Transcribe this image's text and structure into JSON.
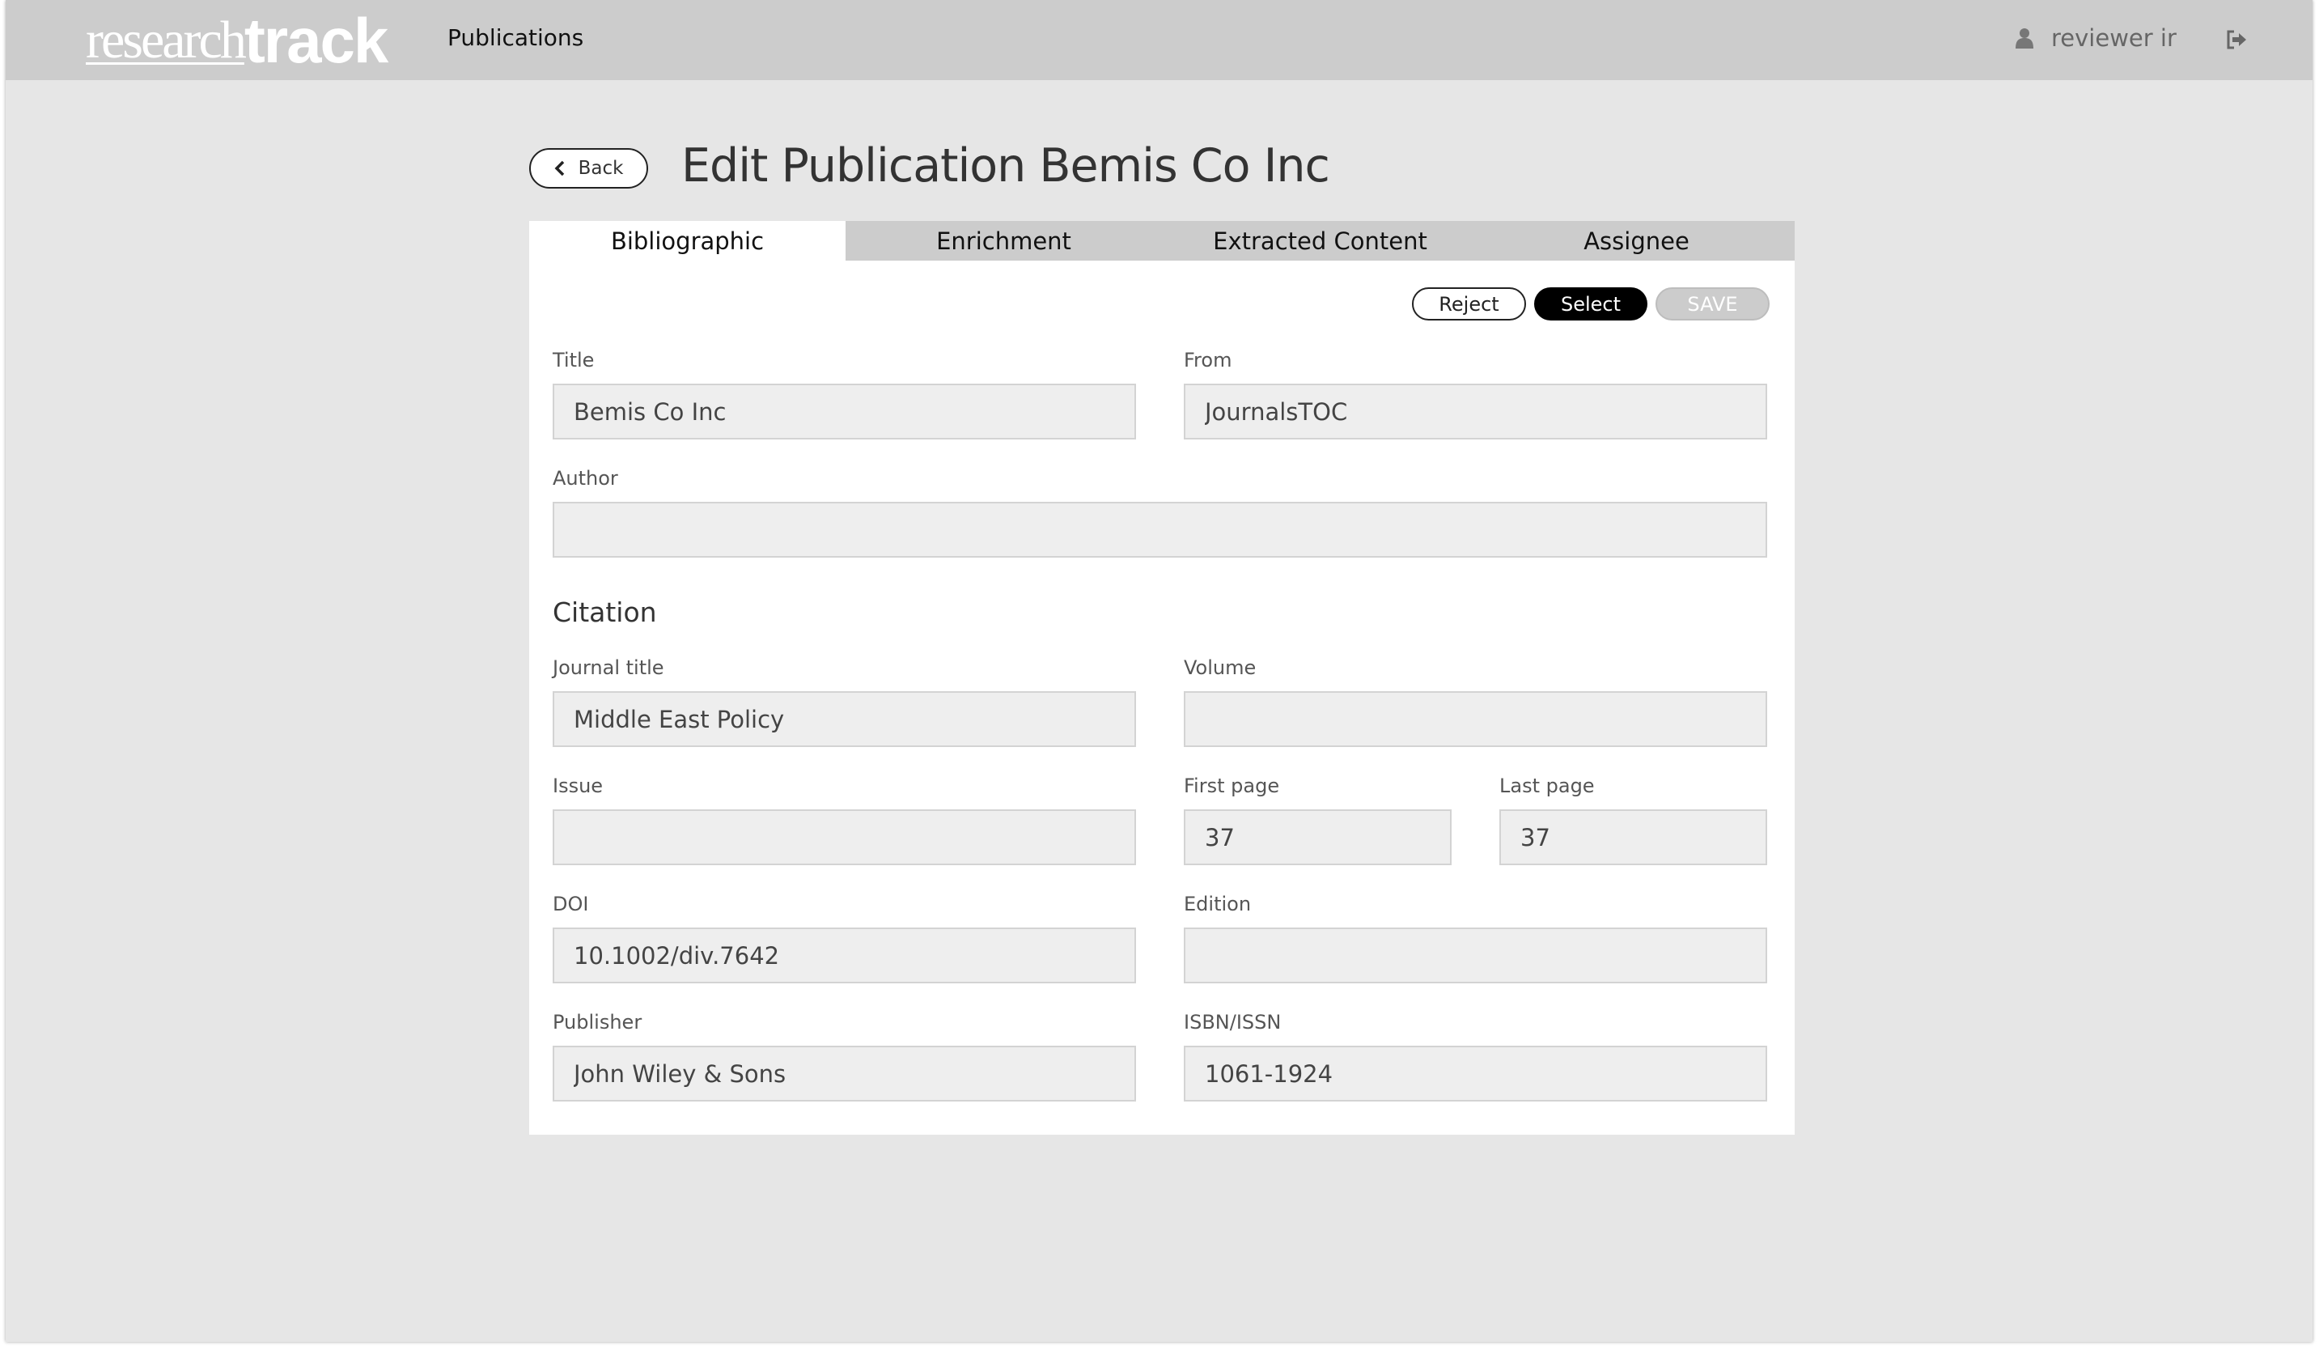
{
  "header": {
    "logo_part1": "research",
    "logo_part2": "track",
    "nav_publications": "Publications",
    "user_name": "reviewer ir"
  },
  "page": {
    "back_label": "Back",
    "title": "Edit Publication Bemis Co Inc"
  },
  "tabs": [
    {
      "label": "Bibliographic",
      "active": true
    },
    {
      "label": "Enrichment",
      "active": false
    },
    {
      "label": "Extracted Content",
      "active": false
    },
    {
      "label": "Assignee",
      "active": false
    }
  ],
  "actions": {
    "reject": "Reject",
    "select": "Select",
    "save": "SAVE"
  },
  "form": {
    "title": {
      "label": "Title",
      "value": "Bemis Co Inc"
    },
    "from": {
      "label": "From",
      "value": "JournalsTOC"
    },
    "author": {
      "label": "Author",
      "value": ""
    },
    "citation_heading": "Citation",
    "journal_title": {
      "label": "Journal title",
      "value": "Middle East Policy"
    },
    "volume": {
      "label": "Volume",
      "value": ""
    },
    "issue": {
      "label": "Issue",
      "value": ""
    },
    "first_page": {
      "label": "First page",
      "value": "37"
    },
    "last_page": {
      "label": "Last page",
      "value": "37"
    },
    "doi": {
      "label": "DOI",
      "value": "10.1002/div.7642"
    },
    "edition": {
      "label": "Edition",
      "value": ""
    },
    "publisher": {
      "label": "Publisher",
      "value": "John Wiley & Sons"
    },
    "isbn_issn": {
      "label": "ISBN/ISSN",
      "value": "1061-1924"
    }
  },
  "colors": {
    "background": "#e6e6e6",
    "topbar": "#cccccc",
    "panel": "#ffffff",
    "field": "#eeeeee",
    "select_button": "#000000",
    "save_disabled": "#cccccc"
  },
  "icons": {
    "user": "user-icon",
    "logout": "logout-icon",
    "back": "chevron-left-icon"
  }
}
